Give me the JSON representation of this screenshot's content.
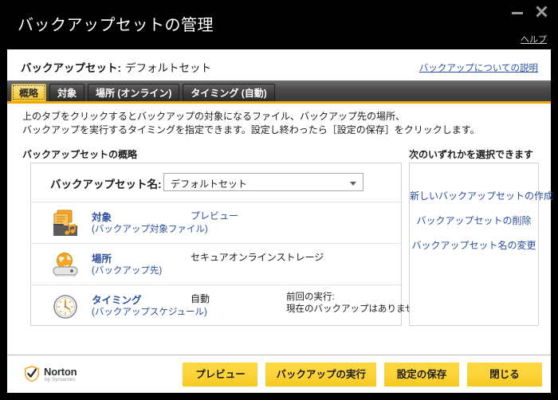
{
  "window": {
    "title": "バックアップセットの管理",
    "minimize_label": "−",
    "close_label": "✕",
    "help_link": "ヘルプ",
    "accent_color": "#f7c81f",
    "titlebar_color": "#000000",
    "link_color": "#2b4f9e"
  },
  "header": {
    "set_label": "バックアップセット:",
    "set_value": "デフォルトセット",
    "about_link": "バックアップについての説明"
  },
  "tabs": [
    {
      "label": "概略",
      "active": true
    },
    {
      "label": "対象",
      "active": false
    },
    {
      "label": "場所 (オンライン)",
      "active": false
    },
    {
      "label": "タイミング (自動)",
      "active": false
    }
  ],
  "intro": {
    "line1": "上のタブをクリックするとバックアップの対象になるファイル、バックアップ先の場所、",
    "line2": "バックアップを実行するタイミングを指定できます。設定し終わったら［設定の保存］をクリックします。"
  },
  "sections": {
    "left_label": "バックアップセットの概略",
    "right_label": "次のいずれかを選択できます"
  },
  "backup_set_name": {
    "label": "バックアップセット名:",
    "value": "デフォルトセット",
    "options": [
      "デフォルトセット"
    ]
  },
  "items": [
    {
      "icon": "documents-music-folder-icon",
      "title": "対象",
      "subtitle": "(バックアップ対象ファイル)",
      "middle": "プレビュー",
      "middle_is_link": true,
      "right": ""
    },
    {
      "icon": "globe-drive-icon",
      "title": "場所",
      "subtitle": "(バックアップ先)",
      "middle": "セキュアオンラインストレージ",
      "middle_is_link": false,
      "right": ""
    },
    {
      "icon": "clock-icon",
      "title": "タイミング",
      "subtitle": "(バックアップスケジュール)",
      "middle": "自動",
      "middle_is_link": false,
      "right_line1": "前回の実行:",
      "right_line2": "現在のバックアップはありません"
    }
  ],
  "side_links": [
    "新しいバックアップセットの作成",
    "バックアップセットの削除",
    "バックアップセット名の変更"
  ],
  "footer": {
    "logo_name": "Norton",
    "logo_sub": "by Symantec",
    "buttons": [
      "プレビュー",
      "バックアップの実行",
      "設定の保存",
      "閉じる"
    ]
  }
}
